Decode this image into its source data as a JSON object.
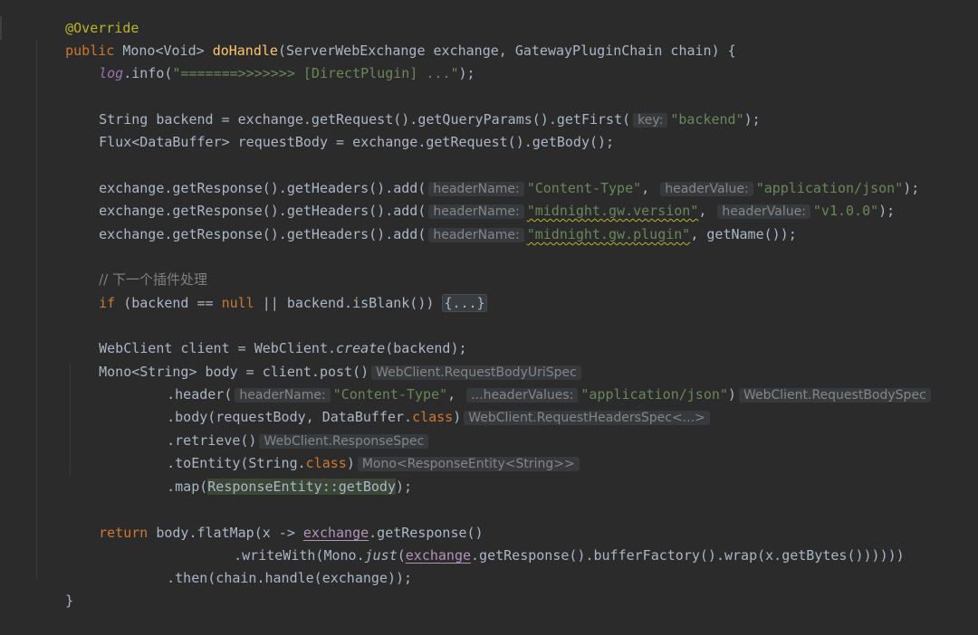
{
  "window": {
    "title": ""
  },
  "code": {
    "l0": {
      "ann": "@Override"
    },
    "l1": {
      "kw": "public",
      "t1": " Mono<Void> ",
      "fn": "doHandle",
      "t2": "(ServerWebExchange exchange, GatewayPluginChain chain) {"
    },
    "l2": {
      "log": "log",
      "t1": ".info(",
      "s": "\"=======>>>>>>> [DirectPlugin] ...\"",
      "t2": ");"
    },
    "l3": {
      "t1": "String backend = exchange.getRequest().getQueryParams().getFirst(",
      "h": "key:",
      "s": "\"backend\"",
      "t2": ");"
    },
    "l4": {
      "t1": "Flux<DataBuffer> requestBody = exchange.getRequest().getBody();"
    },
    "l5": {
      "t1": "exchange.getResponse().getHeaders().add(",
      "h1": "headerName:",
      "s1": "\"Content-Type\"",
      "c": ",",
      "h2": "headerValue:",
      "s2": "\"application/json\"",
      "t2": ");"
    },
    "l6": {
      "t1": "exchange.getResponse().getHeaders().add(",
      "h1": "headerName:",
      "s1": "\"midnight.gw.version\"",
      "c": ",",
      "h2": "headerValue:",
      "s2": "\"v1.0.0\"",
      "t2": ");"
    },
    "l7": {
      "t1": "exchange.getResponse().getHeaders().add(",
      "h1": "headerName:",
      "s1": "\"midnight.gw.plugin\"",
      "t2": ", getName());"
    },
    "l8": {
      "cm": "// 下一个插件处理"
    },
    "l9": {
      "kw1": "if",
      "t1": " (backend == ",
      "kw2": "null",
      "t2": " || backend.isBlank()) ",
      "fold": "{...}"
    },
    "l10": {
      "t1": "WebClient client = WebClient.",
      "it": "create",
      "t2": "(backend);"
    },
    "l11": {
      "t1": "Mono<String> body = client.post()",
      "h": "WebClient.RequestBodyUriSpec"
    },
    "l12": {
      "t1": ".header(",
      "h1": "headerName:",
      "s1": "\"Content-Type\"",
      "c": ",",
      "h2": "...headerValues:",
      "s2": "\"application/json\"",
      "t2": ")",
      "h3": "WebClient.RequestBodySpec"
    },
    "l13": {
      "t1": ".body(requestBody, DataBuffer.",
      "kw": "class",
      "t2": ")",
      "h": "WebClient.RequestHeadersSpec<...>"
    },
    "l14": {
      "t1": ".retrieve()",
      "h": "WebClient.ResponseSpec"
    },
    "l15": {
      "t1": ".toEntity(String.",
      "kw": "class",
      "t2": ")",
      "h": "Mono<ResponseEntity<String>>"
    },
    "l16": {
      "t1": ".map(",
      "hl": "ResponseEntity::getBody",
      "t2": ");"
    },
    "l17": {
      "kw": "return",
      "t1": " body.flatMap(x -> ",
      "u": "exchange",
      "t2": ".getResponse()"
    },
    "l18": {
      "t1": ".writeWith(Mono.",
      "it": "just",
      "t2": "(",
      "u": "exchange",
      "t3": ".getResponse().bufferFactory().wrap(x.getBytes())))))"
    },
    "l19": {
      "t1": ".then(chain.handle(exchange));"
    },
    "l20": {
      "t1": "}"
    }
  }
}
